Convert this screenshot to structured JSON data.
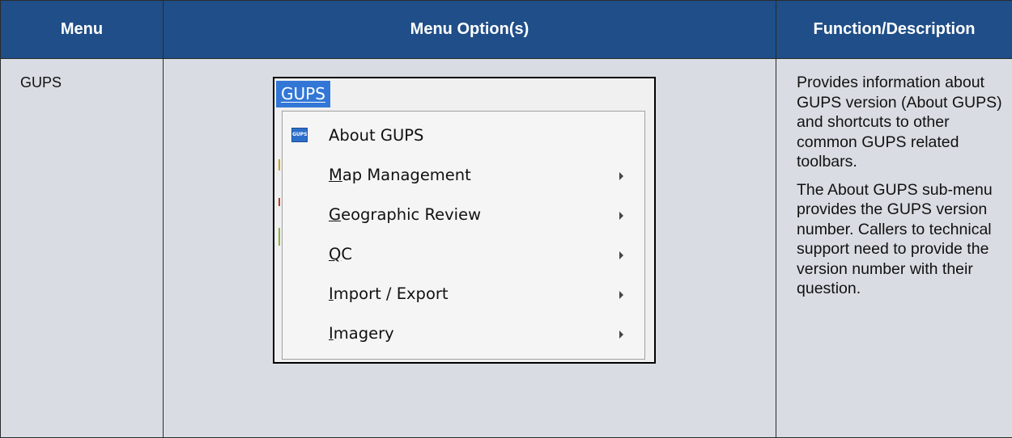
{
  "table": {
    "headers": {
      "menu": "Menu",
      "menu_options": "Menu Option(s)",
      "function_description": "Function/Description"
    },
    "row": {
      "menu": "GUPS",
      "description_paragraphs": [
        "Provides information about GUPS version (About GUPS) and shortcuts to other common GUPS related toolbars.",
        "The About GUPS sub-menu provides the GUPS version number. Callers to technical support need to provide the version number with their question."
      ]
    }
  },
  "menu_screenshot": {
    "menubar_title": "GUPS",
    "items": [
      {
        "label": "About GUPS",
        "icon": "gups-logo-icon",
        "icon_text": "GUPS",
        "has_submenu": false
      },
      {
        "label": "Map Management",
        "has_submenu": true
      },
      {
        "label": "Geographic Review",
        "has_submenu": true
      },
      {
        "label": "QC",
        "has_submenu": true
      },
      {
        "label": "Import / Export",
        "has_submenu": true
      },
      {
        "label": "Imagery",
        "has_submenu": true
      }
    ]
  },
  "colors": {
    "header_bg": "#1f4e88",
    "body_bg": "#d9dde3",
    "menu_highlight": "#3277d6"
  }
}
